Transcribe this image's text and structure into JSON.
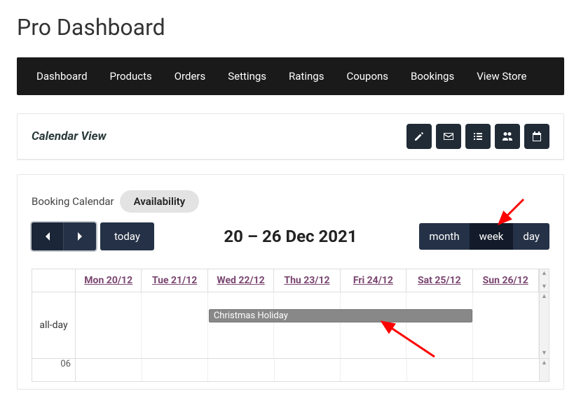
{
  "page_title": "Pro Dashboard",
  "nav": [
    "Dashboard",
    "Products",
    "Orders",
    "Settings",
    "Ratings",
    "Coupons",
    "Bookings",
    "View Store"
  ],
  "panel": {
    "title": "Calendar View"
  },
  "tabs": {
    "label": "Booking Calendar",
    "active": "Availability"
  },
  "controls": {
    "today": "today",
    "date_range": "20 – 26 Dec 2021",
    "views": {
      "month": "month",
      "week": "week",
      "day": "day",
      "active": "week"
    }
  },
  "calendar": {
    "all_day_label": "all-day",
    "day_headers": [
      "Mon 20/12",
      "Tue 21/12",
      "Wed 22/12",
      "Thu 23/12",
      "Fri 24/12",
      "Sat 25/12",
      "Sun 26/12"
    ],
    "event": {
      "title": "Christmas Holiday",
      "start_index": 2,
      "span": 4
    },
    "hour_label": "06"
  }
}
